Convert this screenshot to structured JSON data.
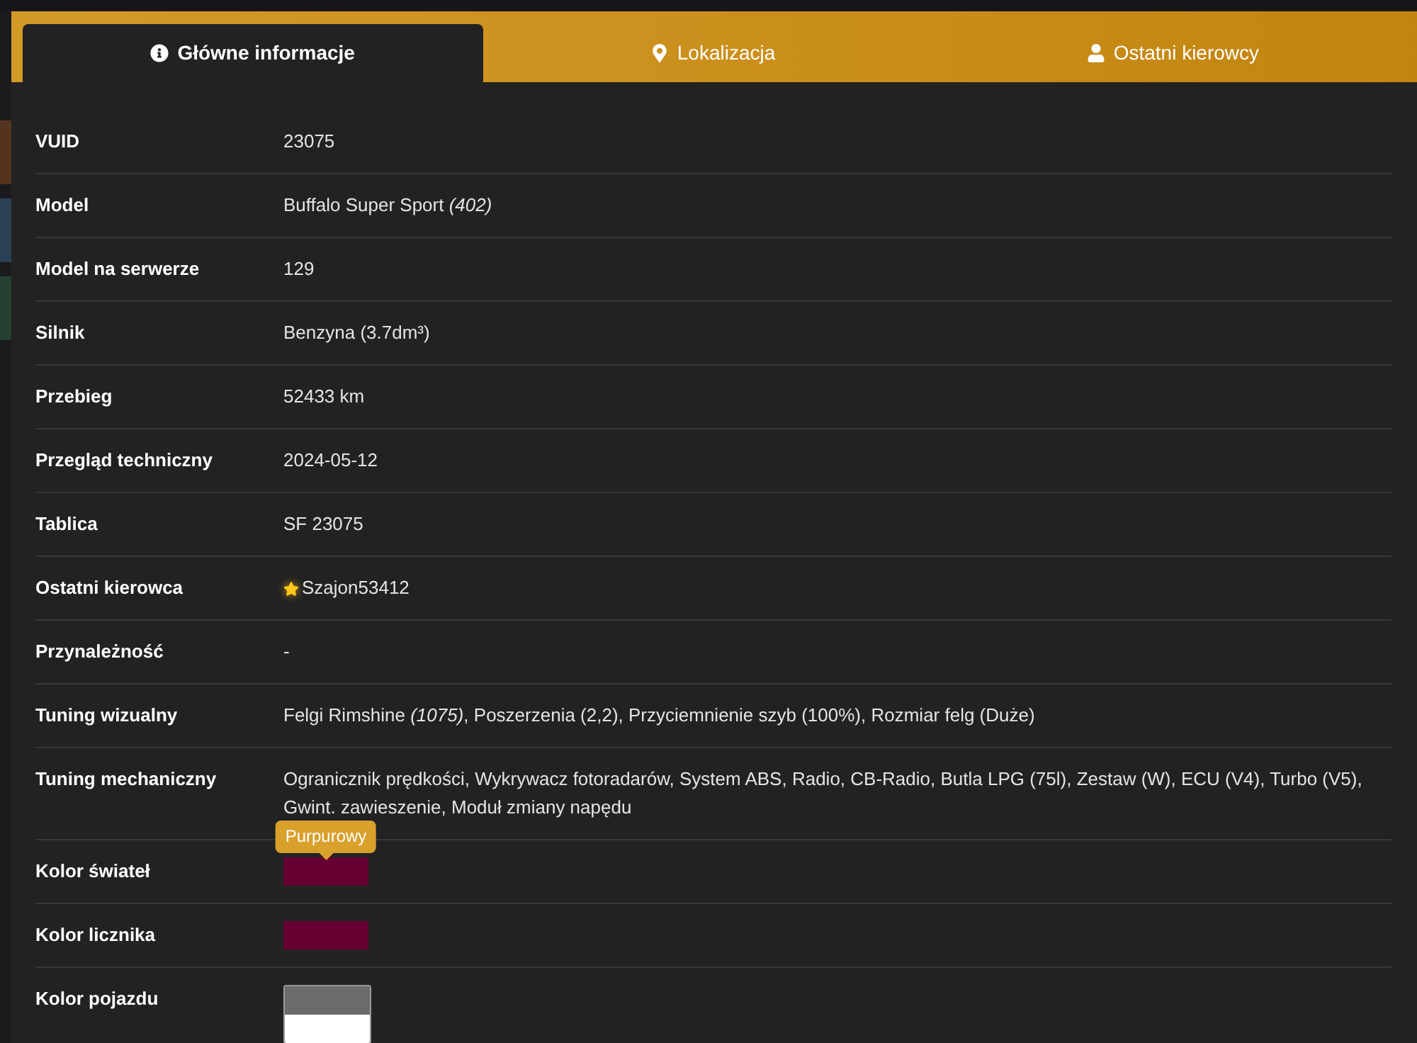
{
  "tabs": [
    {
      "label": "Główne informacje",
      "selected": true
    },
    {
      "label": "Lokalizacja",
      "selected": false
    },
    {
      "label": "Ostatni kierowcy",
      "selected": false
    }
  ],
  "rows": [
    {
      "label": "VUID",
      "kind": "text",
      "value": "23075"
    },
    {
      "label": "Model",
      "kind": "text",
      "value": "Buffalo Super Sport *(402)*"
    },
    {
      "label": "Model na serwerze",
      "kind": "text",
      "value": "129"
    },
    {
      "label": "Silnik",
      "kind": "text",
      "value": "Benzyna (3.7dm³)"
    },
    {
      "label": "Przebieg",
      "kind": "text",
      "value": "52433 km"
    },
    {
      "label": "Przegląd techniczny",
      "kind": "text",
      "value": "2024-05-12"
    },
    {
      "label": "Tablica",
      "kind": "text",
      "value": "SF 23075"
    },
    {
      "label": "Ostatni kierowca",
      "kind": "driver",
      "value": "Szajon53412",
      "starred": true
    },
    {
      "label": "Przynależność",
      "kind": "text",
      "value": "-"
    },
    {
      "label": "Tuning wizualny",
      "kind": "text",
      "value": "Felgi Rimshine *(1075)*, Poszerzenia (2,2), Przyciemnienie szyb (100%), Rozmiar felg (Duże)"
    },
    {
      "label": "Tuning mechaniczny",
      "kind": "text",
      "value": "Ogranicznik prędkości, Wykrywacz fotoradarów, System ABS, Radio, CB-Radio, Butla LPG (75l), Zestaw (W), ECU (V4), Turbo (V5), Gwint. zawieszenie, Moduł zmiany napędu"
    },
    {
      "label": "Kolor świateł",
      "kind": "colors",
      "colors": [
        {
          "color": "#660033"
        }
      ],
      "tooltip": "Purpurowy"
    },
    {
      "label": "Kolor licznika",
      "kind": "colors",
      "colors": [
        {
          "color": "#660033"
        }
      ]
    },
    {
      "label": "Kolor pojazdu",
      "kind": "colors",
      "colors": [
        {
          "color": "#6b6b6b"
        },
        {
          "color": "#ffffff"
        }
      ]
    }
  ]
}
